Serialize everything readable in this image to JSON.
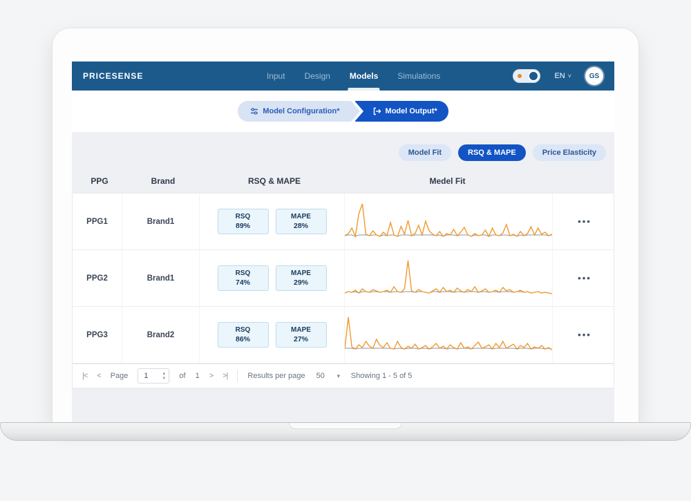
{
  "colors": {
    "navbar": "#1c5a8c",
    "accent_blue": "#1254c4",
    "spark_orange": "#ef9a2d",
    "spark_gray": "#8b93a2"
  },
  "app": {
    "logo": "PRICESENSE"
  },
  "nav": {
    "items": [
      {
        "label": "Input",
        "active": false
      },
      {
        "label": "Design",
        "active": false
      },
      {
        "label": "Models",
        "active": true
      },
      {
        "label": "Simulations",
        "active": false
      }
    ]
  },
  "nav_right": {
    "language": "EN",
    "avatar_initials": "GS"
  },
  "icons": {
    "caret_down": "˅",
    "first_page": "|<",
    "prev_page": "<",
    "next_page": ">",
    "last_page": ">|",
    "spin_up": "▲",
    "spin_down": "▼",
    "select_caret": "▼",
    "more": "•••"
  },
  "stepper": {
    "steps": [
      {
        "label": "Model Configuration*"
      },
      {
        "label": "Model Output*"
      }
    ]
  },
  "filters": {
    "chips": [
      {
        "label": "Model Fit",
        "active": false
      },
      {
        "label": "RSQ & MAPE",
        "active": true
      },
      {
        "label": "Price Elasticity",
        "active": false
      }
    ]
  },
  "table": {
    "headers": {
      "ppg": "PPG",
      "brand": "Brand",
      "rsq_mape": "RSQ & MAPE",
      "model_fit": "Medel Fit"
    },
    "rows": [
      {
        "ppg": "PPG1",
        "brand": "Brand1",
        "rsq_label": "RSQ",
        "rsq_value": "89%",
        "mape_label": "MAPE",
        "mape_value": "28%",
        "sparkline": [
          8,
          14,
          30,
          6,
          72,
          100,
          12,
          8,
          22,
          10,
          6,
          18,
          8,
          46,
          10,
          6,
          35,
          12,
          52,
          8,
          14,
          38,
          10,
          50,
          22,
          12,
          8,
          20,
          6,
          14,
          10,
          26,
          8,
          18,
          32,
          10,
          6,
          14,
          8,
          10,
          24,
          6,
          30,
          10,
          8,
          16,
          40,
          8,
          12,
          6,
          20,
          8,
          14,
          34,
          10,
          30,
          12,
          18,
          8,
          12
        ]
      },
      {
        "ppg": "PPG2",
        "brand": "Brand1",
        "rsq_label": "RSQ",
        "rsq_value": "74%",
        "mape_label": "MAPE",
        "mape_value": "29%",
        "sparkline": [
          6,
          10,
          8,
          14,
          6,
          18,
          10,
          8,
          16,
          12,
          8,
          10,
          14,
          8,
          24,
          10,
          8,
          18,
          100,
          12,
          8,
          16,
          10,
          8,
          6,
          12,
          18,
          8,
          22,
          10,
          14,
          8,
          20,
          12,
          8,
          16,
          10,
          24,
          8,
          12,
          18,
          8,
          10,
          14,
          8,
          22,
          12,
          16,
          8,
          10,
          14,
          8,
          10,
          6,
          8,
          10,
          6,
          8,
          6,
          4
        ]
      },
      {
        "ppg": "PPG3",
        "brand": "Brand2",
        "rsq_label": "RSQ",
        "rsq_value": "86%",
        "mape_label": "MAPE",
        "mape_value": "27%",
        "sparkline": [
          10,
          100,
          14,
          8,
          20,
          12,
          30,
          16,
          10,
          36,
          18,
          12,
          26,
          10,
          8,
          30,
          12,
          8,
          16,
          10,
          22,
          8,
          12,
          18,
          8,
          14,
          24,
          10,
          16,
          8,
          20,
          12,
          8,
          26,
          10,
          14,
          8,
          18,
          28,
          10,
          14,
          20,
          8,
          24,
          12,
          30,
          10,
          16,
          22,
          8,
          18,
          12,
          24,
          8,
          14,
          10,
          18,
          8,
          12,
          6
        ]
      }
    ]
  },
  "pagination": {
    "page_label": "Page",
    "page_value": "1",
    "of_label": "of",
    "total_pages": "1",
    "results_label": "Results per page",
    "results_value": "50",
    "showing_label": "Showing 1 - 5 of 5"
  }
}
